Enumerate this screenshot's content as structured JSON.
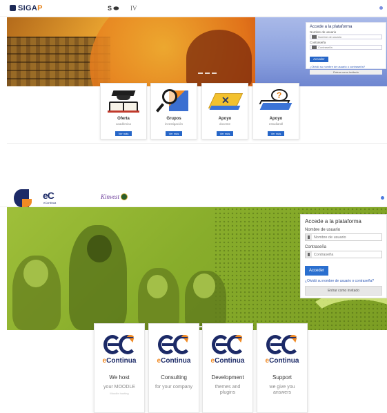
{
  "sigap": {
    "logo_prefix": "SIGA",
    "logo_suffix": "P",
    "partner1": "S ⬬",
    "partner2": "IV",
    "login": {
      "title": "Accede a la plataforma",
      "username_label": "Nombre de usuario",
      "username_placeholder": "Nombre de usuario",
      "password_label": "Contraseña",
      "password_placeholder": "Contraseña",
      "submit": "Acceder",
      "forgot_link": "¿Olvidó su nombre de usuario o contraseña?",
      "guest": "Entrar como invitado"
    },
    "cards": [
      {
        "title": "Oferta",
        "subtitle": "académica",
        "button": "Ver más"
      },
      {
        "title": "Grupos",
        "subtitle": "investigación",
        "button": "Ver más"
      },
      {
        "title": "Apoyo",
        "subtitle": "docente",
        "button": "Ver más"
      },
      {
        "title": "Apoyo",
        "subtitle": "estudiantil",
        "button": "Ver más"
      }
    ]
  },
  "econtinua": {
    "logo": "eC",
    "logo_sub": "eContinua",
    "partner": "Kinvest",
    "login": {
      "title": "Accede a la plataforma",
      "username_label": "Nombre de usuario",
      "username_placeholder": "Nombre de usuario",
      "password_label": "Contraseña",
      "password_placeholder": "Contraseña",
      "submit": "Acceder",
      "forgot_link": "¿Olvidó su nombre de usuario o contraseña?",
      "guest": "Entrar como invitado"
    },
    "brand_word_e": "e",
    "brand_word_rest": "Continua",
    "cards": [
      {
        "title": "We host",
        "subtitle": "your MOODLE",
        "tiny": "Moodle hosting"
      },
      {
        "title": "Consulting",
        "subtitle": "for your company",
        "tiny": ""
      },
      {
        "title": "Development",
        "subtitle": "themes and plugins",
        "tiny": ""
      },
      {
        "title": "Support",
        "subtitle": "we give you answers",
        "tiny": ""
      }
    ]
  },
  "colors": {
    "sigap_navy": "#1d2a57",
    "sigap_orange": "#e5821b",
    "econtinua_navy": "#1c2a67",
    "econtinua_orange": "#f08a24",
    "hero_green": "#88ad2b",
    "button_blue": "#2a6fcf"
  }
}
